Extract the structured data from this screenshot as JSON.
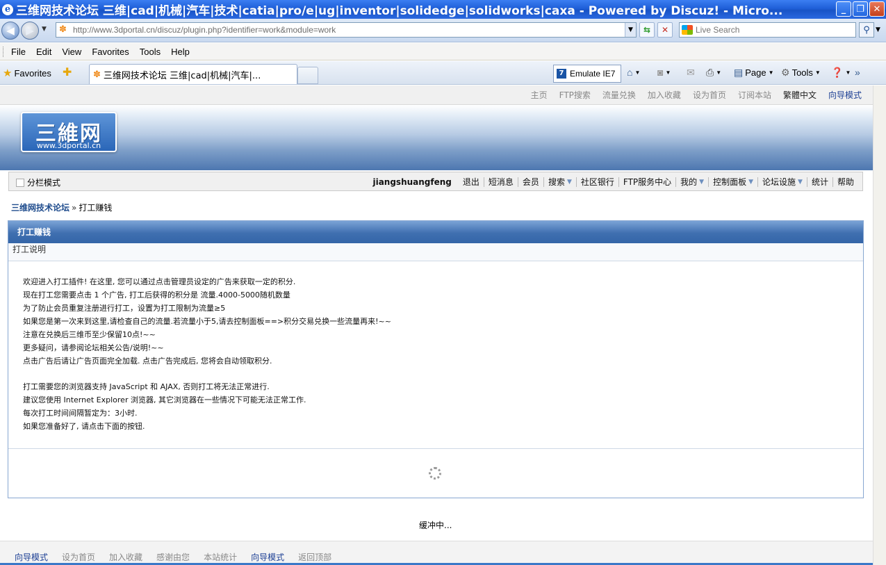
{
  "window": {
    "title": "三维网技术论坛 三维|cad|机械|汽车|技术|catia|pro/e|ug|inventor|solidedge|solidworks|caxa - Powered by Discuz! - Micro...",
    "app_icon": "ie-icon",
    "buttons": {
      "minimize": "_",
      "maximize": "❐",
      "close": "✕"
    }
  },
  "addressbar": {
    "url": "http://www.3dportal.cn/discuz/plugin.php?identifier=work&module=work",
    "search_placeholder": "Live Search"
  },
  "menubar": {
    "items": [
      "File",
      "Edit",
      "View",
      "Favorites",
      "Tools",
      "Help"
    ]
  },
  "favbar": {
    "favorites_label": "Favorites",
    "tab_label": "三维网技术论坛 三维|cad|机械|汽车|...",
    "emulate_label": "Emulate IE7",
    "page_label": "Page",
    "tools_label": "Tools"
  },
  "toplinks": {
    "items": [
      {
        "label": "主页",
        "style": "gray"
      },
      {
        "label": "FTP搜索",
        "style": "gray"
      },
      {
        "label": "流量兑换",
        "style": "gray"
      },
      {
        "label": "加入收藏",
        "style": "gray"
      },
      {
        "label": "设为首页",
        "style": "gray"
      },
      {
        "label": "订阅本站",
        "style": "gray"
      },
      {
        "label": "繁體中文",
        "style": "dark"
      },
      {
        "label": "向导模式",
        "style": "blue"
      }
    ]
  },
  "banner": {
    "logo_text": "三維网",
    "logo_url": "www.3dportal.cn"
  },
  "navbar": {
    "mode_label": "分栏模式",
    "username": "jiangshuangfeng",
    "links": [
      {
        "label": "退出",
        "dropdown": false
      },
      {
        "label": "短消息",
        "dropdown": false
      },
      {
        "label": "会员",
        "dropdown": false
      },
      {
        "label": "搜索",
        "dropdown": true
      },
      {
        "label": "社区银行",
        "dropdown": false
      },
      {
        "label": "FTP服务中心",
        "dropdown": false
      },
      {
        "label": "我的",
        "dropdown": true
      },
      {
        "label": "控制面板",
        "dropdown": true
      },
      {
        "label": "论坛设施",
        "dropdown": true
      },
      {
        "label": "统计",
        "dropdown": false
      },
      {
        "label": "帮助",
        "dropdown": false
      }
    ]
  },
  "breadcrumb": {
    "home": "三维网技术论坛",
    "separator": "»",
    "current": "打工赚钱"
  },
  "main": {
    "header": "打工赚钱",
    "subheader": "打工说明",
    "para1": [
      "欢迎进入打工插件! 在这里, 您可以通过点击管理员设定的广告来获取一定的积分.",
      "现在打工您需要点击  1 个广告, 打工后获得的积分是  流量.4000-5000随机数量",
      "为了防止会员重复注册进行打工，设置为打工限制为流量≥5",
      "如果您是第一次来到这里,请检查自己的流量.若流量小于5,请去控制面板==>积分交易兑换一些流量再来!~~",
      "注意在兑换后三维币至少保留10点!~~",
      "更多疑问，请参阅论坛相关公告/说明!~~",
      "点击广告后请让广告页面完全加载. 点击广告完成后, 您将会自动领取积分."
    ],
    "para2": [
      "打工需要您的浏览器支持  JavaScript 和  AJAX, 否则打工将无法正常进行.",
      "建议您使用  Internet Explorer 浏览器, 其它浏览器在一些情况下可能无法正常工作.",
      "每次打工时间间隔暂定为：3小时.",
      "如果您准备好了, 请点击下面的按钮."
    ],
    "loading_text": "缓冲中..."
  },
  "footer": {
    "links": [
      {
        "label": "向导模式",
        "style": "blue"
      },
      {
        "label": "设为首页",
        "style": "gray"
      },
      {
        "label": "加入收藏",
        "style": "gray"
      },
      {
        "label": "感谢由您",
        "style": "gray"
      },
      {
        "label": "本站统计",
        "style": "gray"
      },
      {
        "label": "向导模式",
        "style": "blue"
      },
      {
        "label": "返回顶部",
        "style": "gray"
      }
    ]
  }
}
